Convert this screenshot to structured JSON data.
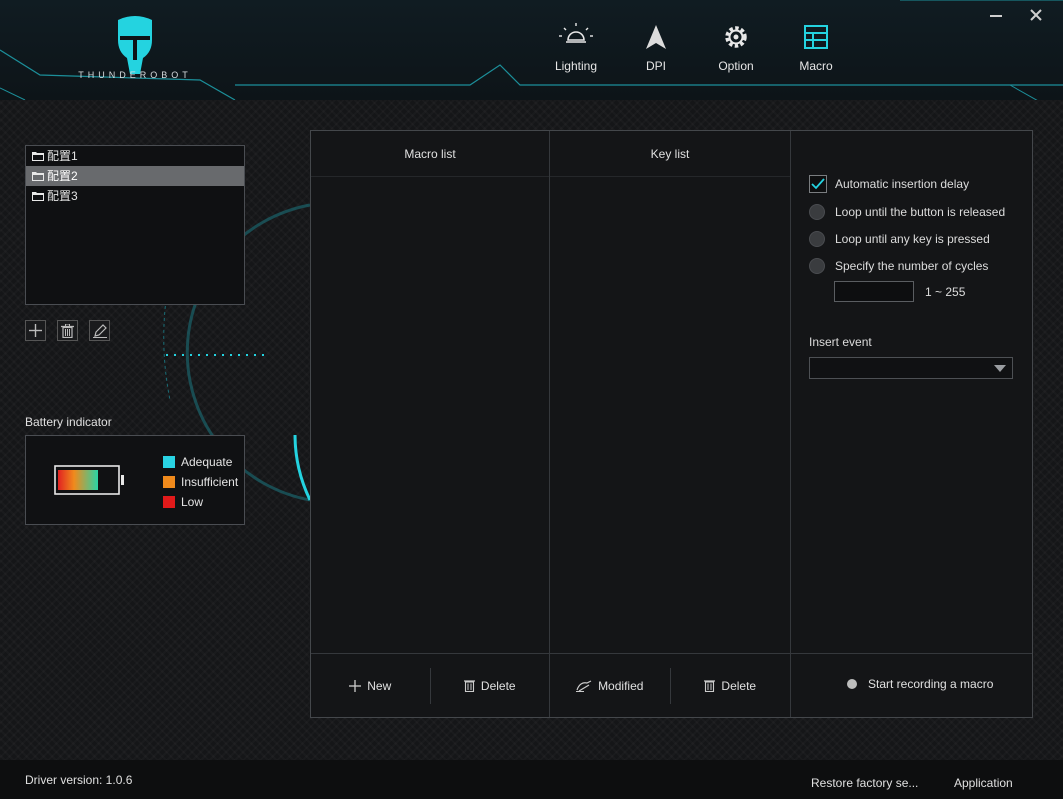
{
  "app": {
    "brand": "THUNDEROBOT",
    "accent_color": "#24d3e0"
  },
  "nav": {
    "items": [
      {
        "label": "Lighting",
        "icon": "lightbulb-icon"
      },
      {
        "label": "DPI",
        "icon": "arrow-cursor-icon"
      },
      {
        "label": "Option",
        "icon": "gear-icon"
      },
      {
        "label": "Macro",
        "icon": "grid-icon"
      }
    ],
    "active": "Macro"
  },
  "window": {
    "minimize_icon": "minimize-icon",
    "close_icon": "close-icon"
  },
  "profiles": {
    "items": [
      "配置1",
      "配置2",
      "配置3"
    ],
    "selected": "配置2"
  },
  "profile_tools": [
    "add-icon",
    "trash-icon",
    "edit-icon"
  ],
  "battery": {
    "title": "Battery indicator",
    "legend": [
      {
        "label": "Adequate",
        "color": "#29d3e3"
      },
      {
        "label": "Insufficient",
        "color": "#f08a1c"
      },
      {
        "label": "Low",
        "color": "#e11a1a"
      }
    ]
  },
  "macro": {
    "macro_list_header": "Macro list",
    "key_list_header": "Key list",
    "new_label": "New",
    "delete_label": "Delete",
    "modified_label": "Modified",
    "key_delete_label": "Delete",
    "options": {
      "auto_delay": {
        "label": "Automatic insertion delay",
        "checked": true
      },
      "loop_release": "Loop until the button is released",
      "loop_any_key": "Loop until any key is pressed",
      "cycles": "Specify the number of cycles",
      "cycles_value": "",
      "cycles_range": "1 ~ 255"
    },
    "insert_event_label": "Insert event",
    "insert_event_value": "",
    "record_label": "Start recording a macro"
  },
  "footer": {
    "driver_version": "Driver version: 1.0.6",
    "restore_label": "Restore factory se...",
    "apply_label": "Application"
  }
}
